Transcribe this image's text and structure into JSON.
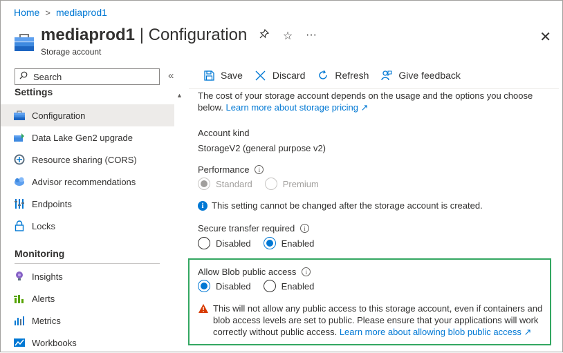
{
  "breadcrumb": {
    "home": "Home",
    "current": "mediaprod1",
    "separator": ">"
  },
  "header": {
    "resource_name": "mediaprod1",
    "page_name": "| Configuration",
    "subtitle": "Storage account",
    "icons": [
      "pin-icon",
      "star-icon",
      "more-icon",
      "close-icon"
    ]
  },
  "search": {
    "placeholder": "Search"
  },
  "sidebar": {
    "settings_header": "Settings",
    "settings_items": [
      {
        "label": "Configuration",
        "icon": "configuration-icon",
        "active": true
      },
      {
        "label": "Data Lake Gen2 upgrade",
        "icon": "data-lake-icon"
      },
      {
        "label": "Resource sharing (CORS)",
        "icon": "cors-icon"
      },
      {
        "label": "Advisor recommendations",
        "icon": "advisor-icon"
      },
      {
        "label": "Endpoints",
        "icon": "endpoints-icon"
      },
      {
        "label": "Locks",
        "icon": "lock-icon"
      }
    ],
    "monitoring_header": "Monitoring",
    "monitoring_items": [
      {
        "label": "Insights",
        "icon": "insights-icon"
      },
      {
        "label": "Alerts",
        "icon": "alerts-icon"
      },
      {
        "label": "Metrics",
        "icon": "metrics-icon"
      },
      {
        "label": "Workbooks",
        "icon": "workbooks-icon"
      }
    ]
  },
  "toolbar": {
    "save": "Save",
    "discard": "Discard",
    "refresh": "Refresh",
    "feedback": "Give feedback"
  },
  "main": {
    "intro_text": "The cost of your storage account depends on the usage and the options you choose below.",
    "intro_link": "Learn more about storage pricing",
    "account_kind_label": "Account kind",
    "account_kind_value": "StorageV2 (general purpose v2)",
    "performance_label": "Performance",
    "performance_options": {
      "standard": "Standard",
      "premium": "Premium",
      "selected": "Standard",
      "disabled": true
    },
    "performance_info": "This setting cannot be changed after the storage account is created.",
    "secure_transfer_label": "Secure transfer required",
    "secure_transfer_options": {
      "disabled": "Disabled",
      "enabled": "Enabled",
      "selected": "Enabled"
    },
    "blob_public_label": "Allow Blob public access",
    "blob_public_options": {
      "disabled": "Disabled",
      "enabled": "Enabled",
      "selected": "Disabled"
    },
    "blob_warning": "This will not allow any public access to this storage account, even if containers and blob access levels are set to public. Please ensure that your applications will work correctly without public access.",
    "blob_warning_link": "Learn more about allowing blob public access"
  },
  "colors": {
    "accent": "#0078d4",
    "highlight_box": "#33a761",
    "warning": "#d83b01",
    "active_nav": "#edebe9"
  }
}
